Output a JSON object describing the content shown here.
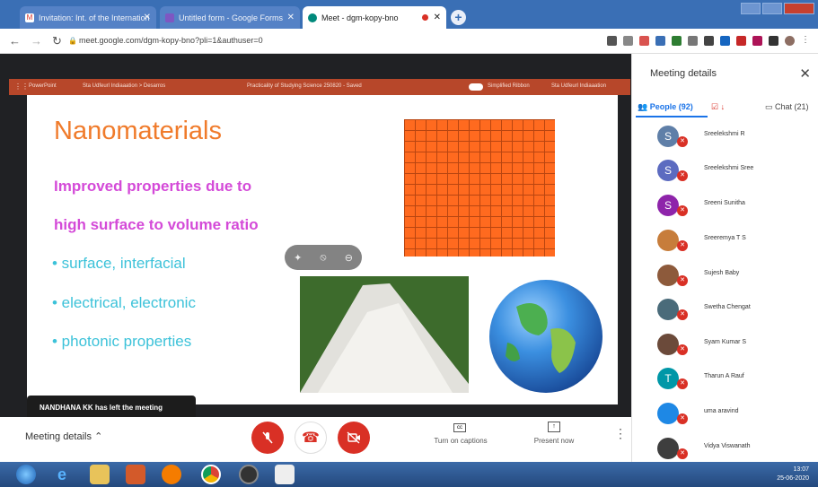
{
  "browser": {
    "tabs": [
      {
        "label": "Invitation: Int. of the Internation",
        "active": false,
        "icon": "gmail-icon"
      },
      {
        "label": "Untitled form - Google Forms",
        "active": false,
        "icon": "forms-icon"
      },
      {
        "label": "Meet - dgm-kopy-bno",
        "active": true,
        "icon": "meet-icon"
      }
    ],
    "url": "meet.google.com/dgm-kopy-bno?pli=1&authuser=0"
  },
  "powerpoint_bar": {
    "app": "PowerPoint",
    "path": "Sta Udfeurl Indiaaation > Desarros",
    "doc": "Practicality of Studying Science 250820 - Saved",
    "toggle": "Simplified Ribbon",
    "user": "Sta Udfeurl Indiaaation"
  },
  "slide": {
    "title": "Nanomaterials",
    "lines": [
      "Improved properties due to",
      "high surface to volume ratio"
    ],
    "bullets": [
      "• surface, interfacial",
      "• electrical, electronic",
      "• photonic properties"
    ]
  },
  "toast": "NANDHANA KK has left the meeting",
  "bottombar": {
    "meeting_details": "Meeting details",
    "captions": "Turn on captions",
    "present": "Present now"
  },
  "panel": {
    "title": "Meeting details",
    "tabs": {
      "people": "People (92)",
      "chat": "Chat (21)"
    },
    "people": [
      {
        "name": "Sreelekshmi R",
        "initial": "S",
        "color": "#5f7fa8"
      },
      {
        "name": "Sreelekshmi Sree",
        "initial": "S",
        "color": "#5c6bc0"
      },
      {
        "name": "Sreeni Sunitha",
        "initial": "S",
        "color": "#8e24aa"
      },
      {
        "name": "Sreeremya T S",
        "initial": "",
        "color": "#c77d3b"
      },
      {
        "name": "Sujesh Baby",
        "initial": "",
        "color": "#8d5a3b"
      },
      {
        "name": "Swetha Chengat",
        "initial": "",
        "color": "#4a6b7a"
      },
      {
        "name": "Syam Kumar S",
        "initial": "",
        "color": "#6b4a3a"
      },
      {
        "name": "Tharun A Rauf",
        "initial": "T",
        "color": "#0097a7"
      },
      {
        "name": "uma aravind",
        "initial": "",
        "color": "#1e88e5"
      },
      {
        "name": "Vidya Viswanath",
        "initial": "",
        "color": "#3e3e3e"
      }
    ]
  },
  "tray": {
    "time": "13:07",
    "date": "25-06-2020"
  }
}
